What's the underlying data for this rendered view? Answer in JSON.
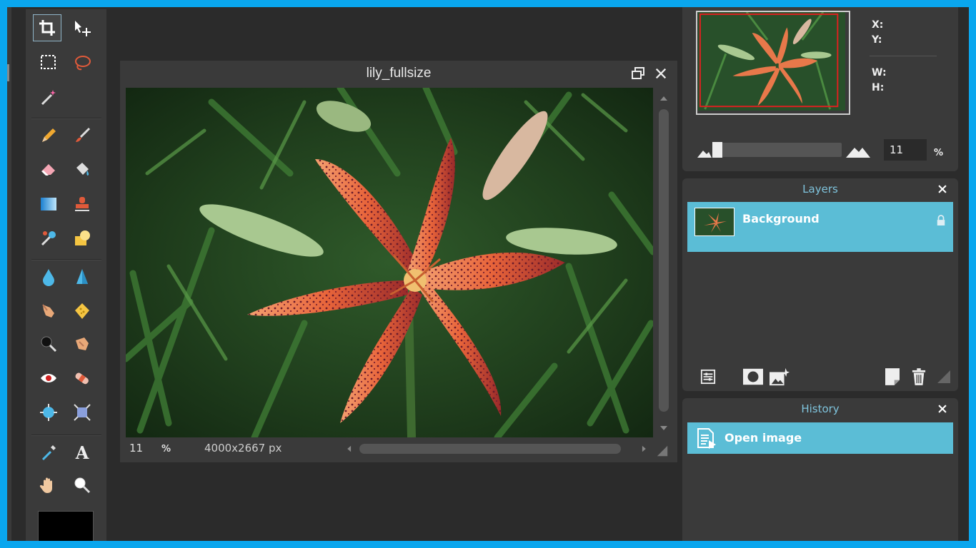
{
  "document": {
    "title": "lily_fullsize",
    "zoom_value": "11",
    "zoom_unit": "%",
    "dimensions": "4000x2667 px"
  },
  "navigator": {
    "x_label": "X:",
    "y_label": "Y:",
    "w_label": "W:",
    "h_label": "H:",
    "zoom_value": "11",
    "zoom_unit": "%"
  },
  "layers": {
    "title": "Layers",
    "items": [
      {
        "name": "Background",
        "locked": true
      }
    ]
  },
  "history": {
    "title": "History",
    "items": [
      {
        "label": "Open image"
      }
    ]
  },
  "colors": {
    "accent": "#0aa6ee",
    "selection": "#5bbdd6",
    "panel": "#3a3a3a",
    "workspace": "#2b2b2b"
  }
}
